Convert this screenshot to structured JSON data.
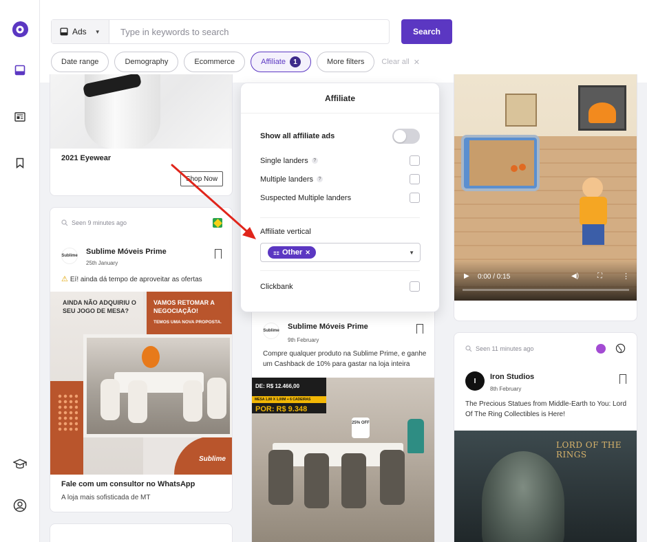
{
  "search": {
    "type_label": "Ads",
    "placeholder": "Type in keywords to search",
    "button": "Search"
  },
  "filters": {
    "chips": [
      "Date range",
      "Demography",
      "Ecommerce"
    ],
    "affiliate_label": "Affiliate",
    "affiliate_count": "1",
    "more": "More filters",
    "clear": "Clear all"
  },
  "panel": {
    "title": "Affiliate",
    "show_all": "Show all affiliate ads",
    "single": "Single landers",
    "multiple": "Multiple landers",
    "suspected": "Suspected Multiple landers",
    "vertical_label": "Affiliate vertical",
    "vertical_tag": "Other",
    "clickbank": "Clickbank",
    "help": "?"
  },
  "cards": {
    "eyewear": {
      "title": "2021 Eyewear",
      "cta": "Shop Now"
    },
    "sublime1": {
      "seen": "Seen 9 minutes ago",
      "advertiser": "Sublime Móveis Prime",
      "date": "25th January",
      "text": "Eí! ainda dá tempo de aproveitar as ofertas",
      "img_text_left": "AINDA NÃO ADQUIRIU O SEU JOGO DE MESA?",
      "img_text_right1": "VAMOS RETOMAR A NEGOCIAÇÃO!",
      "img_text_right2": "TEMOS UMA NOVA PROPOSTA.",
      "img_brand": "Sublime",
      "headline": "Fale com um consultor no WhatsApp",
      "sub": "A loja mais sofisticada de MT"
    },
    "sublime2": {
      "advertiser": "Sublime Móveis Prime",
      "date": "9th February",
      "text": "Compre qualquer produto na Sublime Prime, e ganhe um Cashback de 10% para gastar na loja inteira",
      "price_from": "DE: R$ 12.466,00",
      "price_desc": "MESA 1,80 X 1,00M + 6 CADEIRAS",
      "price_now": "POR: R$ 9.348",
      "discount": "25% OFF"
    },
    "video": {
      "time": "0:00 / 0:15"
    },
    "iron": {
      "seen": "Seen 11 minutes ago",
      "advertiser": "Iron Studios",
      "date": "8th February",
      "text": "The Precious Statues from Middle-Earth to You: Lord Of The Ring Collectibles is Here!",
      "logo": "LORD OF THE RINGS"
    }
  },
  "colors": {
    "accent": "#5b37c2",
    "arrow": "#e0251b"
  }
}
